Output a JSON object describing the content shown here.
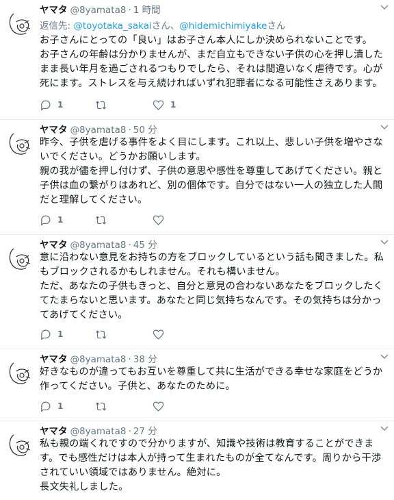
{
  "tweets": [
    {
      "name": "ヤマタ",
      "handle": "@8yamata8",
      "time": "1 時間",
      "reply_label": "返信先: ",
      "reply_mention_1": "@toyotaka_sakai",
      "reply_suffix_1": "さん、",
      "reply_mention_2": "@hidemichimiyake",
      "reply_suffix_2": "さん",
      "text": "お子さんにとっての「良い」はお子さん本人にしか決められないことです。\nお子さんの年齢は分かりませんが、まだ自立もできない子供の心を押し潰した\nまま長い年月を過ごされるつもりでしたら、それは間違いなく虐待です。心が\n死にます。ストレスを与え続ければいずれ犯罪者になる可能性さえあります。",
      "reply_count": "1",
      "retweet_count": "",
      "like_count": "1"
    },
    {
      "name": "ヤマタ",
      "handle": "@8yamata8",
      "time": "50 分",
      "text": "昨今、子供を虐げる事件をよく目にします。これ以上、悲しい子供を増やさな\nいでください。どうかお願いします。\n親の我が儘を押し付けず、子供の意思や感性を尊重してあげてください。親と\n子供は血の繋がりはあれど、別の個体です。自分ではない一人の独立した人間\nだと理解してください。",
      "reply_count": "1",
      "retweet_count": "",
      "like_count": ""
    },
    {
      "name": "ヤマタ",
      "handle": "@8yamata8",
      "time": "45 分",
      "text": "意に沿わない意見をお持ちの方をブロックしているという話も聞きました。私\nもブロックされるかもしれません。それも構いません。\nただ、あなたの子供もきっと、自分と意見の合わないあなたをブロックしたく\nてたまらないと思います。あなたと同じ気持ちなんです。その気持ちは分かっ\nてあげてください。",
      "reply_count": "1",
      "retweet_count": "",
      "like_count": ""
    },
    {
      "name": "ヤマタ",
      "handle": "@8yamata8",
      "time": "38 分",
      "text": "好きなものが違ってもお互いを尊重して共に生活ができる幸せな家庭をどうか\n作ってください。子供と、あなたのために。",
      "reply_count": "1",
      "retweet_count": "",
      "like_count": ""
    },
    {
      "name": "ヤマタ",
      "handle": "@8yamata8",
      "time": "27 分",
      "text": "私も親の端くれですので分かりますが、知識や技術は教育することができま\nす。でも感性だけは本人が持って生まれたものが全てなんです。周りから干渉\nされていい領域ではありません。絶対に。\n長文失礼しました。",
      "reply_count": "",
      "retweet_count": "",
      "like_count": ""
    }
  ],
  "colors": {
    "secondary": "#657786",
    "link": "#1da1f2",
    "divider": "#e6ecf0"
  },
  "icons": {
    "reply": "reply-icon",
    "retweet": "retweet-icon",
    "like": "heart-icon",
    "menu": "chevron-down-icon"
  }
}
